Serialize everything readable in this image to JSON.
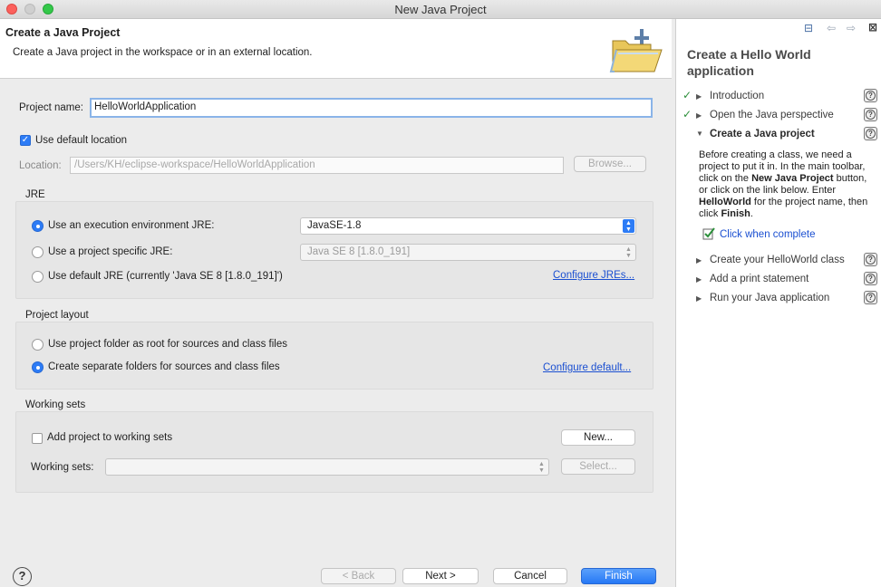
{
  "window": {
    "title": "New Java Project"
  },
  "header": {
    "title": "Create a Java Project",
    "description": "Create a Java project in the workspace or in an external location."
  },
  "project": {
    "name_label": "Project name:",
    "name_value": "HelloWorldApplication",
    "use_default_location_label": "Use default location",
    "use_default_location_checked": true,
    "location_label": "Location:",
    "location_value": "/Users/KH/eclipse-workspace/HelloWorldApplication",
    "browse_label": "Browse..."
  },
  "jre": {
    "group_title": "JRE",
    "option_env_label": "Use an execution environment JRE:",
    "option_env_value": "JavaSE-1.8",
    "option_specific_label": "Use a project specific JRE:",
    "option_specific_value": "Java SE 8 [1.8.0_191]",
    "option_default_label": "Use default JRE (currently 'Java SE 8 [1.8.0_191]')",
    "configure_link": "Configure JREs...",
    "selected": "env"
  },
  "layout": {
    "group_title": "Project layout",
    "option_root_label": "Use project folder as root for sources and class files",
    "option_separate_label": "Create separate folders for sources and class files",
    "configure_link": "Configure default...",
    "selected": "separate"
  },
  "working_sets": {
    "group_title": "Working sets",
    "add_label": "Add project to working sets",
    "add_checked": false,
    "new_button": "New...",
    "sets_label": "Working sets:",
    "select_button": "Select..."
  },
  "footer": {
    "back": "< Back",
    "next": "Next >",
    "cancel": "Cancel",
    "finish": "Finish"
  },
  "cheatsheet": {
    "title": "Create a Hello World application",
    "items": [
      {
        "label": "Introduction",
        "status": "done"
      },
      {
        "label": "Open the Java perspective",
        "status": "done"
      },
      {
        "label": "Create a Java project",
        "status": "current"
      },
      {
        "label": "Create your HelloWorld class",
        "status": "pending"
      },
      {
        "label": "Add a print statement",
        "status": "pending"
      },
      {
        "label": "Run your Java application",
        "status": "pending"
      }
    ],
    "desc_1": "Before creating a class, we need a project to put it in. In the main toolbar, click on the ",
    "desc_b1": "New Java Project",
    "desc_2": " button, or click on the link below. Enter ",
    "desc_b2": "HelloWorld",
    "desc_3": " for the project name, then click ",
    "desc_b3": "Finish",
    "desc_4": ".",
    "click_when_complete": "Click when complete"
  },
  "colors": {
    "accent": "#2d7cf6",
    "link": "#1a4fd1",
    "check": "#2c8f3a"
  }
}
